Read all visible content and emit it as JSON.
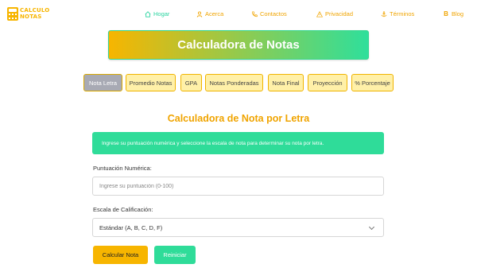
{
  "brand": {
    "line1": "CALCULO",
    "line2": "NOTAS",
    "logo_icon": "calculator-icon",
    "color": "#f7b500"
  },
  "nav": [
    {
      "label": "Hogar",
      "icon": "home-icon",
      "color": "#2bd4a0"
    },
    {
      "label": "Acerca",
      "icon": "user-icon",
      "color": "#f0a400"
    },
    {
      "label": "Contactos",
      "icon": "phone-icon",
      "color": "#f0a400"
    },
    {
      "label": "Privacidad",
      "icon": "warning-icon",
      "color": "#f0a400"
    },
    {
      "label": "Términos",
      "icon": "anchor-icon",
      "color": "#f0a400"
    },
    {
      "label": "Blog",
      "icon": "bitcoin-icon",
      "color": "#f0a400"
    }
  ],
  "banner": {
    "title": "Calculadora de Notas"
  },
  "tabs": [
    {
      "label": "Nota Letra",
      "active": true
    },
    {
      "label": "Promedio Notas",
      "active": false
    },
    {
      "label": "GPA",
      "active": false
    },
    {
      "label": "Notas Ponderadas",
      "active": false
    },
    {
      "label": "Nota Final",
      "active": false
    },
    {
      "label": "Proyección",
      "active": false
    },
    {
      "label": "% Porcentaje",
      "active": false
    }
  ],
  "main": {
    "title": "Calculadora de Nota por Letra",
    "info": "Ingrese su puntuación numérica y seleccione la escala de nota para determinar su nota por letra.",
    "score_label": "Puntuación Numérica:",
    "score_placeholder": "Ingrese su puntuación (0-100)",
    "score_value": "",
    "scale_label": "Escala de Calificación:",
    "scale_selected": "Estándar (A, B, C, D, F)",
    "calc_button": "Calcular Nota",
    "reset_button": "Reiniciar"
  },
  "colors": {
    "accent_yellow": "#f7b500",
    "accent_green": "#2fdc99",
    "tab_active": "#a8aab4",
    "tab_bg": "#fff0a8"
  }
}
